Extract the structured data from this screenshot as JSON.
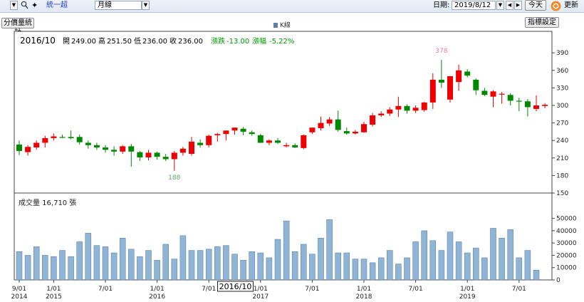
{
  "toolbar": {
    "stock_name": "統一超",
    "period": "月線",
    "date_label": "日期:",
    "date_value": "2019/8/12",
    "today_label": "今天",
    "refresh_label": "更新"
  },
  "buttons": {
    "volume_stats": "分價量統計",
    "indicator_settings": "指標設定"
  },
  "legend_label": "K線",
  "info": {
    "period": "2016/10",
    "open_label": "開",
    "open": "249.00",
    "high_label": "高",
    "high": "251.50",
    "low_label": "低",
    "low": "236.00",
    "close_label": "收",
    "close": "236.00",
    "change_label": "漲跌",
    "change": "-13.00",
    "change_pct_label": "漲幅",
    "change_pct": "-5.22%"
  },
  "volume_label": "成交量 16,710 張",
  "annotations": {
    "high": "378",
    "low": "188"
  },
  "cursor_label": "2016/10",
  "colors": {
    "up": "#ee0000",
    "down": "#008800",
    "volume": "#8fb4d6",
    "volume_edge": "#4e7aa5",
    "high_ann": "#f07aa0",
    "low_ann": "#5aab5a",
    "info_change": "#009900"
  },
  "chart_data": [
    {
      "type": "candlestick",
      "y_ticks": [
        150,
        180,
        210,
        240,
        270,
        300,
        330,
        360,
        390
      ],
      "ylim": [
        150,
        400
      ],
      "x_ticks": [
        {
          "index": 0,
          "line1": "9/01",
          "line2": "2014"
        },
        {
          "index": 4,
          "line1": "1/01",
          "line2": "2015"
        },
        {
          "index": 10,
          "line1": "7/01",
          "line2": ""
        },
        {
          "index": 16,
          "line1": "1/01",
          "line2": "2016"
        },
        {
          "index": 22,
          "line1": "7/01",
          "line2": ""
        },
        {
          "index": 28,
          "line1": "1/01",
          "line2": "2017"
        },
        {
          "index": 34,
          "line1": "7/01",
          "line2": ""
        },
        {
          "index": 40,
          "line1": "1/01",
          "line2": "2018"
        },
        {
          "index": 46,
          "line1": "7/01",
          "line2": ""
        },
        {
          "index": 52,
          "line1": "1/01",
          "line2": "2019"
        },
        {
          "index": 58,
          "line1": "7/01",
          "line2": ""
        }
      ],
      "ohlc": [
        [
          233,
          240,
          215,
          222
        ],
        [
          220,
          232,
          214,
          229
        ],
        [
          228,
          240,
          224,
          236
        ],
        [
          236,
          248,
          228,
          244
        ],
        [
          244,
          252,
          240,
          247
        ],
        [
          246,
          250,
          244,
          245
        ],
        [
          246,
          257,
          242,
          244
        ],
        [
          246,
          250,
          233,
          237
        ],
        [
          236,
          240,
          226,
          232
        ],
        [
          232,
          236,
          224,
          228
        ],
        [
          228,
          232,
          219,
          224
        ],
        [
          224,
          230,
          214,
          221
        ],
        [
          221,
          232,
          217,
          230
        ],
        [
          230,
          234,
          195,
          221
        ],
        [
          220,
          222,
          205,
          211
        ],
        [
          211,
          224,
          206,
          219
        ],
        [
          219,
          221,
          207,
          212
        ],
        [
          212,
          217,
          205,
          208
        ],
        [
          208,
          222,
          188,
          219
        ],
        [
          219,
          229,
          214,
          226
        ],
        [
          217,
          246,
          214,
          238
        ],
        [
          236,
          242,
          228,
          232
        ],
        [
          232,
          250,
          228,
          248
        ],
        [
          249,
          253,
          238,
          251
        ],
        [
          251,
          257,
          240,
          257
        ],
        [
          257,
          262,
          250,
          262
        ],
        [
          260,
          263,
          249,
          255
        ],
        [
          254,
          257,
          248,
          251
        ],
        [
          249,
          251.5,
          236,
          236
        ],
        [
          236,
          242,
          232,
          240
        ],
        [
          240,
          244,
          234,
          236
        ],
        [
          230,
          236,
          228,
          232
        ],
        [
          232,
          235,
          227,
          228
        ],
        [
          227,
          250,
          225,
          249
        ],
        [
          254,
          262,
          251,
          262
        ],
        [
          261,
          281,
          257,
          270
        ],
        [
          269,
          280,
          265,
          276
        ],
        [
          276,
          291,
          255,
          258
        ],
        [
          256,
          262,
          250,
          252
        ],
        [
          252,
          258,
          250,
          255
        ],
        [
          254,
          272,
          253,
          268
        ],
        [
          267,
          287,
          264,
          283
        ],
        [
          283,
          290,
          280,
          286
        ],
        [
          286,
          297,
          282,
          293
        ],
        [
          293,
          315,
          280,
          299
        ],
        [
          299,
          302,
          286,
          291
        ],
        [
          291,
          300,
          287,
          296
        ],
        [
          292,
          306,
          289,
          305
        ],
        [
          305,
          355,
          294,
          344
        ],
        [
          344,
          378,
          330,
          339
        ],
        [
          310,
          350,
          305,
          350
        ],
        [
          340,
          370,
          325,
          360
        ],
        [
          358,
          362,
          348,
          351
        ],
        [
          344,
          346,
          318,
          326
        ],
        [
          325,
          330,
          316,
          318
        ],
        [
          315,
          326,
          297,
          324
        ],
        [
          320,
          323,
          303,
          320
        ],
        [
          318,
          321,
          300,
          308
        ],
        [
          308,
          313,
          290,
          307
        ],
        [
          307,
          311,
          281,
          297
        ],
        [
          294,
          317,
          290,
          300
        ],
        [
          299,
          304,
          295,
          301
        ],
        [
          301,
          312,
          296,
          299
        ],
        [
          297,
          301,
          293,
          293
        ]
      ],
      "volume_label": "成交量",
      "volume_ticks": [
        0,
        10000,
        20000,
        30000,
        40000,
        50000
      ],
      "volume_ylim": [
        0,
        55000
      ],
      "volume": [
        23000,
        20000,
        27000,
        20000,
        19000,
        24000,
        19000,
        31000,
        38000,
        28000,
        27000,
        22000,
        34000,
        25000,
        19000,
        24000,
        16000,
        29000,
        17000,
        36000,
        24000,
        24000,
        25000,
        27000,
        28000,
        21000,
        16000,
        23000,
        22000,
        18000,
        33000,
        48000,
        23000,
        29000,
        21000,
        34000,
        49000,
        22000,
        22000,
        17000,
        17000,
        14000,
        18000,
        24000,
        13000,
        18000,
        31000,
        40000,
        32000,
        24000,
        39000,
        31000,
        22000,
        26000,
        18000,
        42000,
        34000,
        41000,
        18000,
        24000,
        8000
      ]
    }
  ]
}
